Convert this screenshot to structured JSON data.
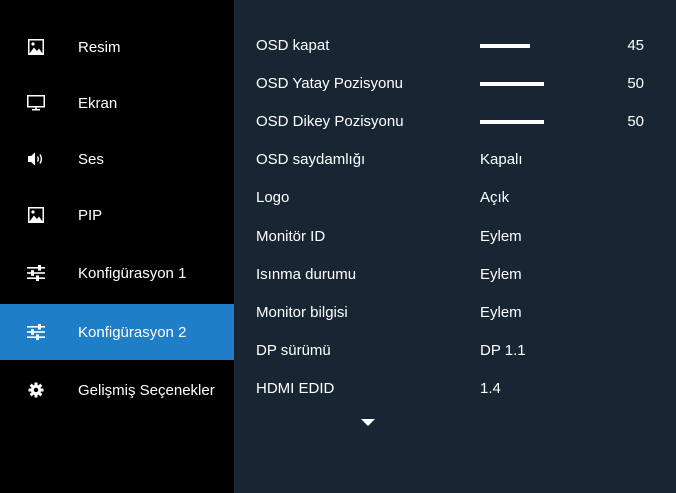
{
  "sidebar": {
    "items": [
      {
        "label": "Resim",
        "icon": "picture-icon",
        "active": false
      },
      {
        "label": "Ekran",
        "icon": "monitor-icon",
        "active": false
      },
      {
        "label": "Ses",
        "icon": "speaker-icon",
        "active": false
      },
      {
        "label": "PIP",
        "icon": "picture-icon",
        "active": false
      },
      {
        "label": "Konfigürasyon 1",
        "icon": "sliders-icon",
        "active": false
      },
      {
        "label": "Konfigürasyon 2",
        "icon": "sliders-icon",
        "active": true
      },
      {
        "label": "Gelişmiş Seçenekler",
        "icon": "gear-icon",
        "active": false
      }
    ]
  },
  "settings": {
    "rows": [
      {
        "label": "OSD kapat",
        "type": "slider",
        "value": "45",
        "fill": 0.45
      },
      {
        "label": "OSD Yatay Pozisyonu",
        "type": "slider",
        "value": "50",
        "fill": 0.5
      },
      {
        "label": "OSD Dikey Pozisyonu",
        "type": "slider",
        "value": "50",
        "fill": 0.5
      },
      {
        "label": "OSD saydamlığı",
        "type": "text",
        "value": "Kapalı"
      },
      {
        "label": "Logo",
        "type": "text",
        "value": "Açık"
      },
      {
        "label": "Monitör ID",
        "type": "text",
        "value": "Eylem"
      },
      {
        "label": "Isınma durumu",
        "type": "text",
        "value": "Eylem"
      },
      {
        "label": "Monitor bilgisi",
        "type": "text",
        "value": "Eylem"
      },
      {
        "label": "DP sürümü",
        "type": "text",
        "value": "DP 1.1"
      },
      {
        "label": "HDMI EDID",
        "type": "text",
        "value": "1.4"
      }
    ]
  },
  "colors": {
    "active": "#1f7ec8",
    "panel": "#182532",
    "sidebar": "#000000"
  },
  "scroll_indicator_icon": "arrow-down-icon"
}
